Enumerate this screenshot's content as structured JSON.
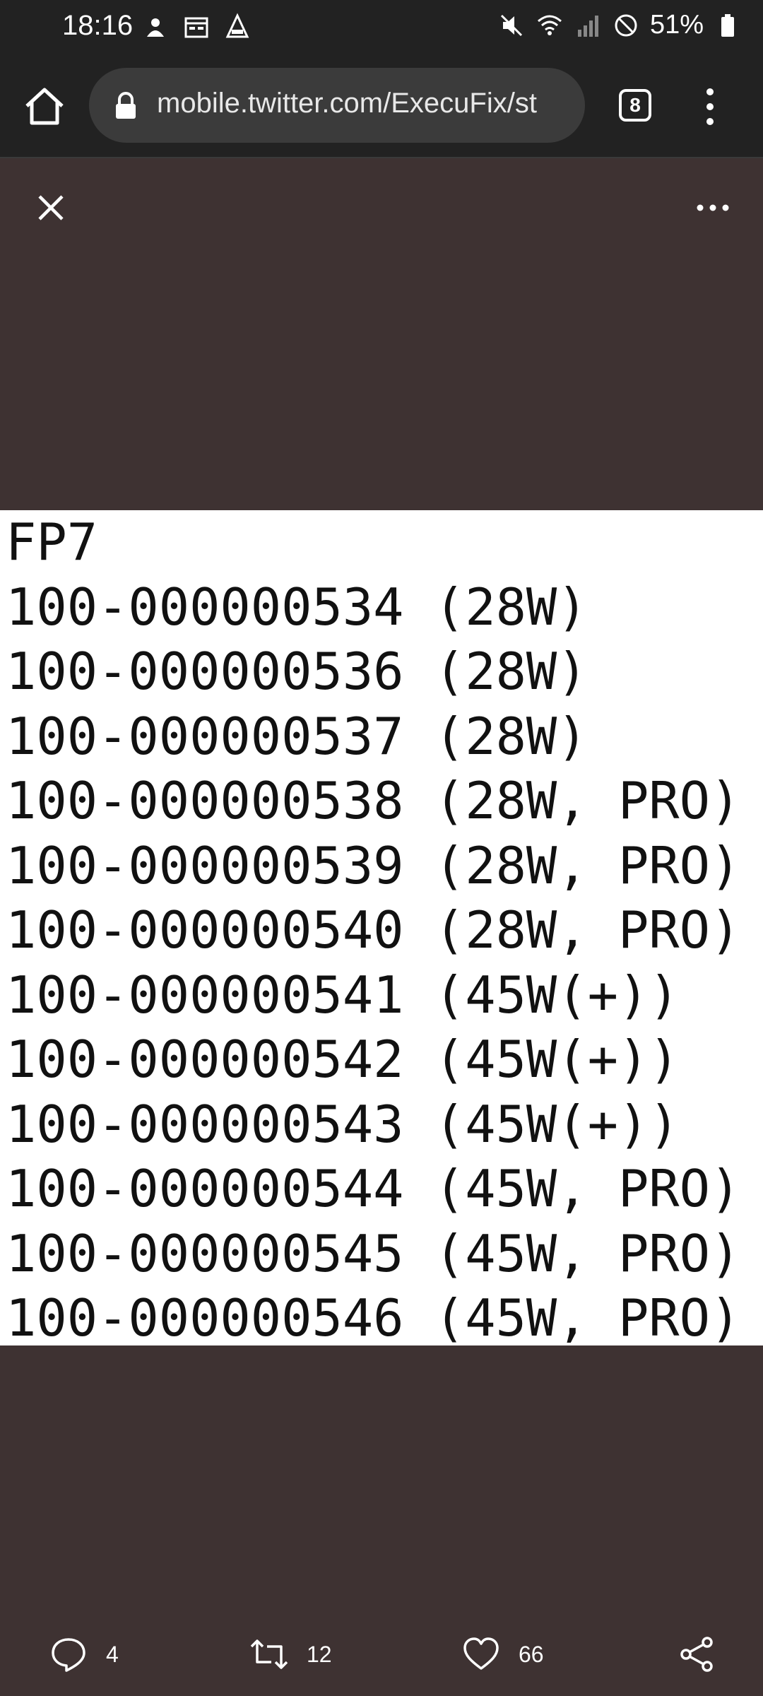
{
  "status_bar": {
    "time": "18:16",
    "battery": "51%"
  },
  "browser": {
    "url": "mobile.twitter.com/ExecuFix/st",
    "tab_count": "8"
  },
  "image": {
    "lines": [
      "FP7",
      "100-000000534 (28W)",
      "100-000000536 (28W)",
      "100-000000537 (28W)",
      "100-000000538 (28W, PRO)",
      "100-000000539 (28W, PRO)",
      "100-000000540 (28W, PRO)",
      "100-000000541 (45W(+))",
      "100-000000542 (45W(+))",
      "100-000000543 (45W(+))",
      "100-000000544 (45W, PRO)",
      "100-000000545 (45W, PRO)",
      "100-000000546 (45W, PRO)"
    ]
  },
  "actions": {
    "replies": "4",
    "retweets": "12",
    "likes": "66"
  }
}
